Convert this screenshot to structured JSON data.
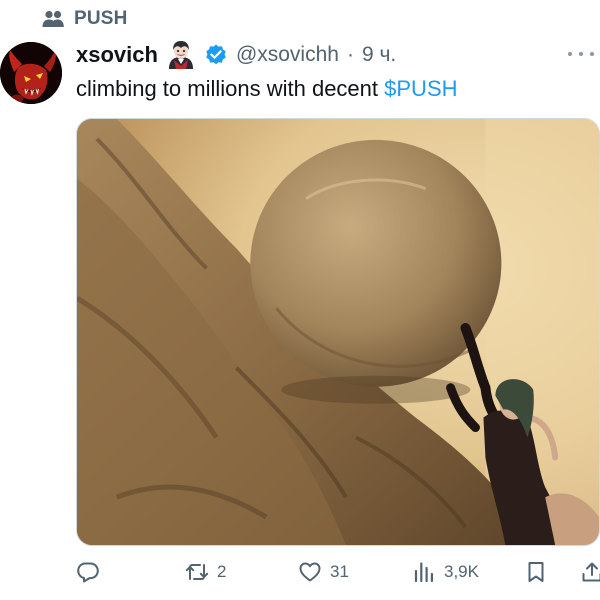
{
  "community": {
    "name": "PUSH",
    "icon": "community-icon"
  },
  "tweet": {
    "author": {
      "display_name": "xsovich",
      "name_emoji": "vampire-emoji",
      "verified": true,
      "handle": "@xsovichh",
      "separator": "·",
      "time": "9 ч."
    },
    "text_before": "climbing to millions with decent ",
    "cashtag": "$PUSH",
    "media": {
      "icon": "sisyphus-meme-image"
    }
  },
  "actions": {
    "reply": {
      "icon": "reply-icon",
      "count": ""
    },
    "retweet": {
      "icon": "retweet-icon",
      "count": "2"
    },
    "like": {
      "icon": "heart-icon",
      "count": "31"
    },
    "views": {
      "icon": "views-chart-icon",
      "count": "3,9K"
    },
    "bookmark": {
      "icon": "bookmark-icon"
    },
    "share": {
      "icon": "share-icon"
    }
  },
  "colors": {
    "accent": "#1d9bf0",
    "text_primary": "#0f1419",
    "text_secondary": "#536471"
  }
}
